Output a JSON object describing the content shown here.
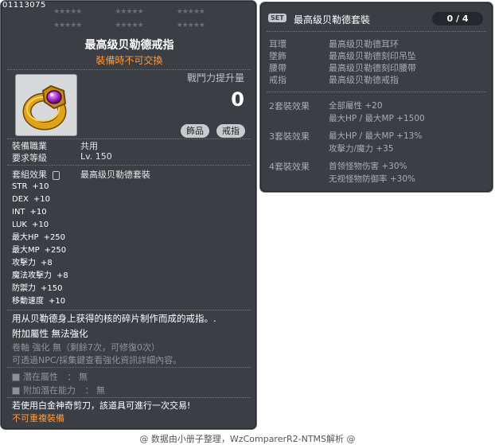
{
  "item": {
    "id": "01113075",
    "star_groups": [
      "★★★★★",
      "★★★★★",
      "★★★★★"
    ],
    "name": "最高级贝勒德戒指",
    "subtitle": "裝備時不可交換",
    "combat_power_label": "戰鬥力提升量",
    "combat_power_value": "0",
    "tags": [
      "飾品",
      "戒指"
    ],
    "job_label": "裝備職業",
    "job_value": "共用",
    "level_label": "要求等級",
    "level_value": "Lv. 150",
    "set_effect_label": "套組效果",
    "set_name": "最高级贝勒德套裝",
    "stats": [
      {
        "name": "STR",
        "value": "+10"
      },
      {
        "name": "DEX",
        "value": "+10"
      },
      {
        "name": "INT",
        "value": "+10"
      },
      {
        "name": "LUK",
        "value": "+10"
      },
      {
        "name": "最大HP",
        "value": "+250"
      },
      {
        "name": "最大MP",
        "value": "+250"
      },
      {
        "name": "攻擊力",
        "value": "+8"
      },
      {
        "name": "魔法攻擊力",
        "value": "+8"
      },
      {
        "name": "防禦力",
        "value": "+150"
      },
      {
        "name": "移動速度",
        "value": "+10"
      }
    ],
    "description": "用从贝勒德身上获得的核的碎片制作而成的戒指。.",
    "extra_attr_label": "附加屬性",
    "extra_attr_value": "無法強化",
    "scroll_line": "卷軸 強化 無（剩餘7次，可修復0次）",
    "npc_line": "可透過NPC/採集鍵查看強化資訊詳細內容。",
    "potential_label": "潛在屬性",
    "potential_value": "： 無",
    "bonus_potential_label": "附加潛在能力",
    "bonus_potential_value": "： 無",
    "scissors_line": "若使用白金神奇剪刀，該道具可進行一次交易!",
    "unique_line": "不可重複裝備"
  },
  "set_panel": {
    "badge": "SET",
    "title": "最高级贝勒德套裝",
    "count": "0 / 4",
    "items": [
      {
        "slot": "耳環",
        "name": "最高级贝勒德耳环"
      },
      {
        "slot": "墜飾",
        "name": "最高级贝勒德刻印吊坠"
      },
      {
        "slot": "腰帶",
        "name": "最高级贝勒德刻印腰带"
      },
      {
        "slot": "戒指",
        "name": "最高级贝勒德戒指"
      }
    ],
    "effects": [
      {
        "label": "2套裝效果",
        "lines": [
          "全部屬性 +20",
          "最大HP / 最大MP +1500"
        ]
      },
      {
        "label": "3套裝效果",
        "lines": [
          "最大HP / 最大MP +13%",
          "攻擊力/魔力 +35"
        ]
      },
      {
        "label": "4套裝效果",
        "lines": [
          "首领怪物伤害 +30%",
          "无视怪物防御率 +30%"
        ]
      }
    ]
  },
  "footer": "@ 数据由小册子整理，WzComparerR2-NTMS解析 @"
}
